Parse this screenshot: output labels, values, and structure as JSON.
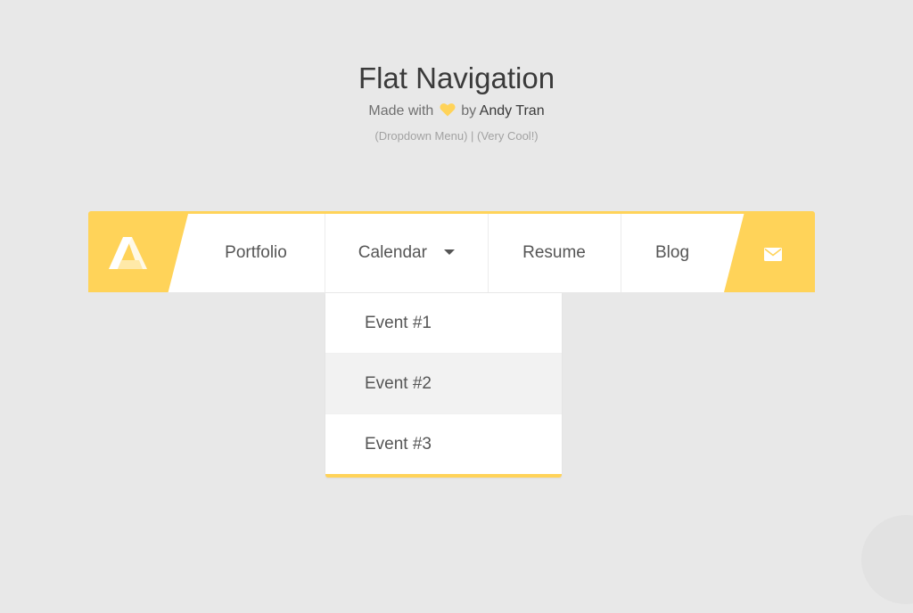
{
  "header": {
    "title": "Flat Navigation",
    "made_with": "Made with",
    "by": "by",
    "author": "Andy Tran",
    "note": "(Dropdown Menu) | (Very Cool!)"
  },
  "nav": {
    "items": [
      {
        "label": "Portfolio"
      },
      {
        "label": "Calendar"
      },
      {
        "label": "Resume"
      },
      {
        "label": "Blog"
      }
    ],
    "logo_icon": "brand-a-logo",
    "mail_icon": "envelope-icon"
  },
  "dropdown": {
    "items": [
      {
        "label": "Event #1"
      },
      {
        "label": "Event #2"
      },
      {
        "label": "Event #3"
      }
    ],
    "highlighted_index": 1
  },
  "colors": {
    "accent": "#ffd359",
    "background": "#e8e8e8",
    "text": "#555555"
  }
}
